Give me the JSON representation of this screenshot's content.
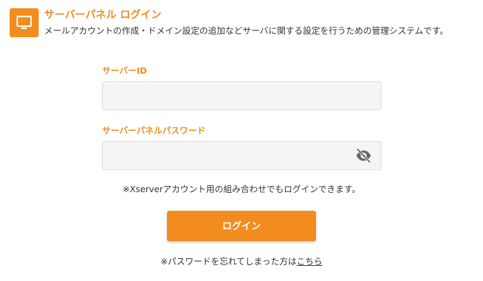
{
  "header": {
    "icon": "monitor-icon",
    "title": "サーバーパネル ログイン",
    "description": "メールアカウントの作成・ドメイン設定の追加などサーバに関する設定を行うための管理システムです。"
  },
  "form": {
    "server_id_label": "サーバーID",
    "server_id_value": "",
    "password_label": "サーバーパネルパスワード",
    "password_value": "",
    "password_toggle_icon": "eye-slash-icon",
    "note": "※Xserverアカウント用の組み合わせでもログインできます。",
    "login_button": "ログイン"
  },
  "forgot": {
    "prefix": "※パスワードを忘れてしまった方は",
    "link": "こちら"
  },
  "colors": {
    "accent": "#f28c1e",
    "input_background": "#f5f5f5",
    "text": "#333333"
  }
}
